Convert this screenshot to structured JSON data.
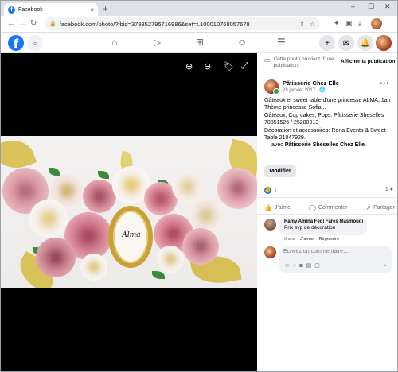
{
  "browser": {
    "tab_title": "Facebook",
    "tab_close": "×",
    "new_tab": "+",
    "url": "facebook.com/photo/?fbid=379852795716986&set=t.100010768057678",
    "window_controls": [
      "–",
      "☐",
      "✕"
    ]
  },
  "fb_header": {
    "logo": "f"
  },
  "notice": {
    "text": "Cette photo provient d'une publication.",
    "hide_button": "Afficher la publication"
  },
  "post": {
    "author": "Pâtisserie Chez Elle",
    "date": "28 janvier 2017 · ",
    "lines": [
      "Gâteaux et sweet table d'une princesse ALMA, 1an",
      "Thème princesse Sofia...",
      "Gâteaux, Cup cakes, Pops: Pâtisserie Sheselles 70851526 / 25280013",
      "Décoration et accessoires: Rena Events & Sweet Table 21047929."
    ],
    "with_prefix": "— avec ",
    "with_name": "Pâtisserie Sheselles Chez Elle",
    "with_suffix": ".",
    "edit_button": "Modifier",
    "like_count": "1",
    "comment_count": "1",
    "actions": {
      "like": "J'aime",
      "comment": "Commenter",
      "share": "Partager"
    },
    "photo_logo_text": "Alma"
  },
  "comment": {
    "author": "Ramy Amina Fedi Fares Masmoudi",
    "text": "Prix svp de décoration",
    "age": "6 ans",
    "like": "J'aime",
    "reply": "Répondre"
  },
  "composer": {
    "placeholder": "Écrivez un commentaire…"
  }
}
